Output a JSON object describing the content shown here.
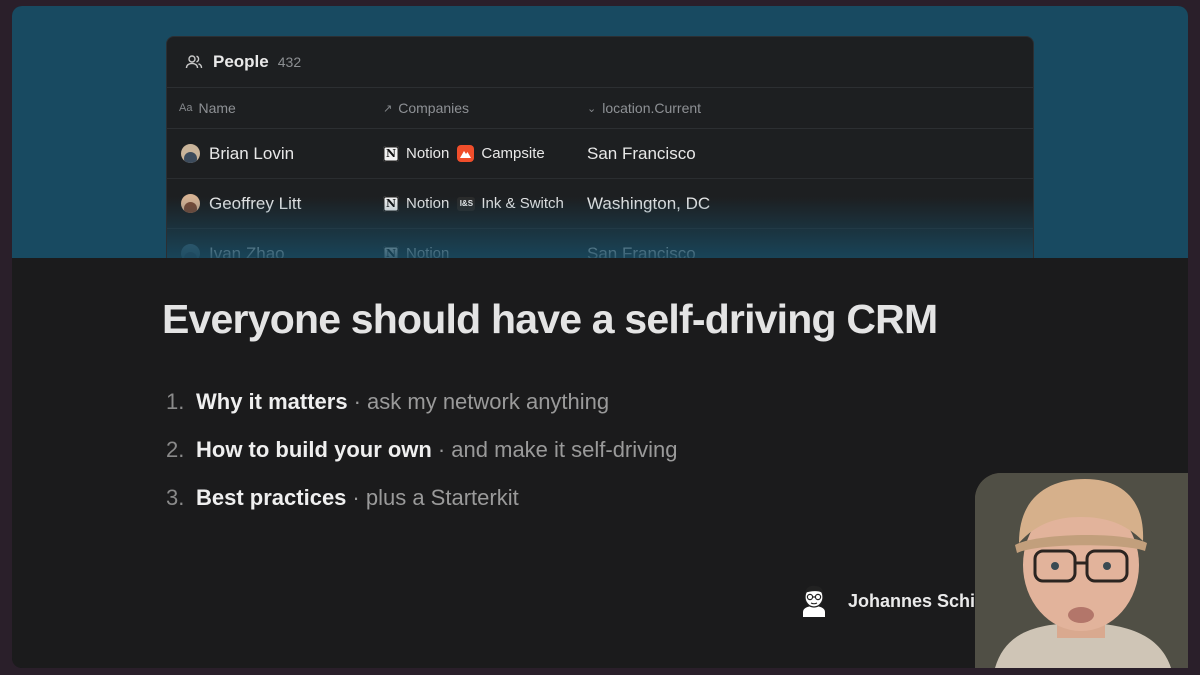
{
  "table": {
    "title": "People",
    "count": "432",
    "columns": [
      {
        "icon": "Aa",
        "label": "Name"
      },
      {
        "icon": "↗",
        "label": "Companies"
      },
      {
        "icon": "⌄",
        "label": "location.Current"
      }
    ],
    "rows": [
      {
        "name": "Brian Lovin",
        "companies": [
          "Notion",
          "Campsite"
        ],
        "location": "San Francisco"
      },
      {
        "name": "Geoffrey Litt",
        "companies": [
          "Notion",
          "Ink & Switch"
        ],
        "location": "Washington, DC"
      },
      {
        "name": "Ivan Zhao",
        "companies": [
          "Notion"
        ],
        "location": "San Francisco"
      }
    ],
    "logo_text": {
      "notion": "N",
      "ink": "I&S"
    }
  },
  "slide": {
    "title": "Everyone should have a self-driving CRM",
    "agenda": [
      {
        "num": "1.",
        "strong": "Why it matters",
        "rest": "· ask my network anything"
      },
      {
        "num": "2.",
        "strong": "How to build your own",
        "rest": "· and make it self-driving"
      },
      {
        "num": "3.",
        "strong": "Best practices",
        "rest": "· plus a Starterkit"
      }
    ]
  },
  "presenter": {
    "name": "Johannes Schickling"
  },
  "colors": {
    "hero": "#184a61",
    "background": "#1b1b1c",
    "campsite": "#f04e2b"
  }
}
